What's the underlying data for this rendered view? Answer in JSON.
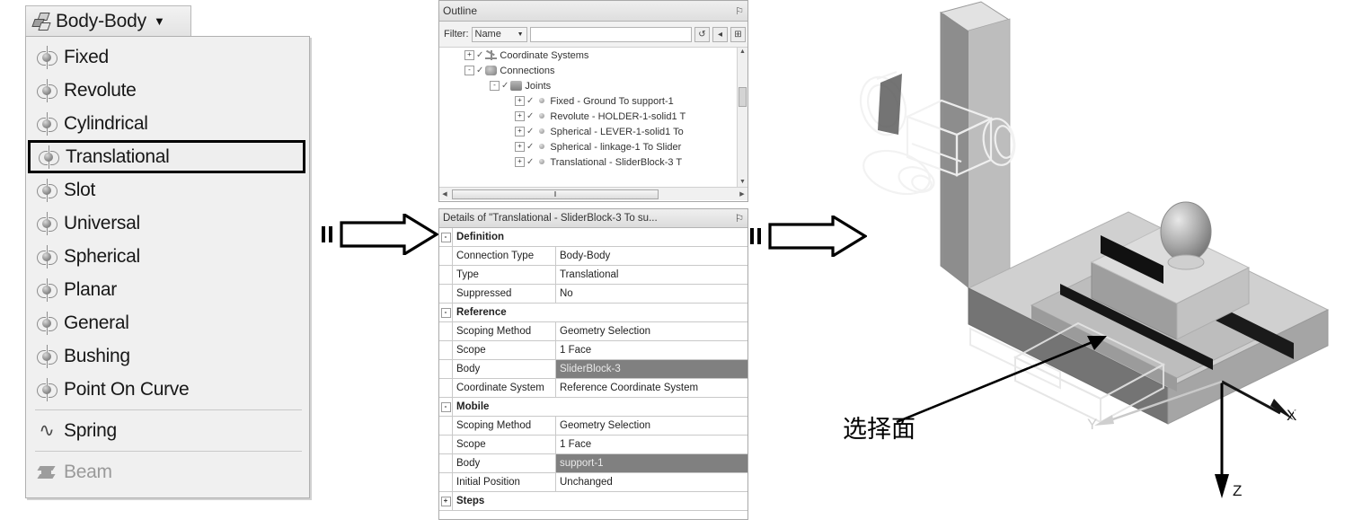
{
  "dropdown": {
    "button_label": "Body-Body",
    "button_icon": "bodies-icon",
    "caret": "▼",
    "items": [
      {
        "label": "Fixed",
        "icon": "joint-icon",
        "state": "normal"
      },
      {
        "label": "Revolute",
        "icon": "joint-icon",
        "state": "normal"
      },
      {
        "label": "Cylindrical",
        "icon": "joint-icon",
        "state": "normal"
      },
      {
        "label": "Translational",
        "icon": "joint-icon",
        "state": "selected"
      },
      {
        "label": "Slot",
        "icon": "joint-icon",
        "state": "normal"
      },
      {
        "label": "Universal",
        "icon": "joint-icon",
        "state": "normal"
      },
      {
        "label": "Spherical",
        "icon": "joint-icon",
        "state": "normal"
      },
      {
        "label": "Planar",
        "icon": "joint-icon",
        "state": "normal"
      },
      {
        "label": "General",
        "icon": "joint-icon",
        "state": "normal"
      },
      {
        "label": "Bushing",
        "icon": "joint-icon",
        "state": "normal"
      },
      {
        "label": "Point On Curve",
        "icon": "joint-icon",
        "state": "normal"
      },
      {
        "label": "Spring",
        "icon": "spring-icon",
        "state": "normal"
      },
      {
        "label": "Beam",
        "icon": "beam-icon",
        "state": "disabled"
      }
    ]
  },
  "outline": {
    "title": "Outline",
    "pin": "⚐",
    "filter": {
      "label": "Filter:",
      "select_value": "Name",
      "text_value": "",
      "text_placeholder": "",
      "buttons": [
        "refresh-icon",
        "clear-filter-icon",
        "expand-all-icon"
      ]
    },
    "tree": [
      {
        "label": "Coordinate Systems",
        "depth": 1,
        "expander": "+",
        "icon": "coordinate-system-icon"
      },
      {
        "label": "Connections",
        "depth": 1,
        "expander": "-",
        "icon": "connections-icon"
      },
      {
        "label": "Joints",
        "depth": 2,
        "expander": "-",
        "icon": "joints-folder-icon"
      },
      {
        "label": "Fixed - Ground To support-1",
        "depth": 3,
        "expander": "+",
        "icon": "joint-icon"
      },
      {
        "label": "Revolute - HOLDER-1-solid1 T",
        "depth": 3,
        "expander": "+",
        "icon": "joint-icon"
      },
      {
        "label": "Spherical - LEVER-1-solid1 To",
        "depth": 3,
        "expander": "+",
        "icon": "joint-icon"
      },
      {
        "label": "Spherical - linkage-1 To Slider",
        "depth": 3,
        "expander": "+",
        "icon": "joint-icon"
      },
      {
        "label": "Translational - SliderBlock-3 T",
        "depth": 3,
        "expander": "+",
        "icon": "joint-icon"
      }
    ],
    "hscroll_grip": "‖"
  },
  "details": {
    "title": "Details of \"Translational - SliderBlock-3 To su...",
    "pin": "⚐",
    "rows": [
      {
        "kind": "section",
        "name": "Definition",
        "expander": "-"
      },
      {
        "kind": "row",
        "key": "Connection Type",
        "value": "Body-Body",
        "highlight": false
      },
      {
        "kind": "row",
        "key": "Type",
        "value": "Translational",
        "highlight": false
      },
      {
        "kind": "row",
        "key": "Suppressed",
        "value": "No",
        "highlight": false
      },
      {
        "kind": "section",
        "name": "Reference",
        "expander": "-"
      },
      {
        "kind": "row",
        "key": "Scoping Method",
        "value": "Geometry Selection",
        "highlight": false
      },
      {
        "kind": "row",
        "key": "Scope",
        "value": "1 Face",
        "highlight": false
      },
      {
        "kind": "row",
        "key": "Body",
        "value": "SliderBlock-3",
        "highlight": true
      },
      {
        "kind": "row",
        "key": "Coordinate System",
        "value": "Reference Coordinate System",
        "highlight": false
      },
      {
        "kind": "section",
        "name": "Mobile",
        "expander": "-"
      },
      {
        "kind": "row",
        "key": "Scoping Method",
        "value": "Geometry Selection",
        "highlight": false
      },
      {
        "kind": "row",
        "key": "Scope",
        "value": "1 Face",
        "highlight": false
      },
      {
        "kind": "row",
        "key": "Body",
        "value": "support-1",
        "highlight": true
      },
      {
        "kind": "row",
        "key": "Initial Position",
        "value": "Unchanged",
        "highlight": false
      },
      {
        "kind": "section",
        "name": "Steps",
        "expander": "+"
      }
    ]
  },
  "arrows": {
    "arrow1_name": "flow-arrow-1",
    "arrow2_name": "flow-arrow-2"
  },
  "viewport": {
    "annotation": "选择面",
    "axes": {
      "x": "X",
      "y": "Y",
      "z": "Z"
    },
    "marker": "+"
  },
  "colors": {
    "menu_bg": "#f0f0f0",
    "highlight_row": "#808080",
    "selection_border": "#000000",
    "panel_border": "#a9a9a9"
  }
}
